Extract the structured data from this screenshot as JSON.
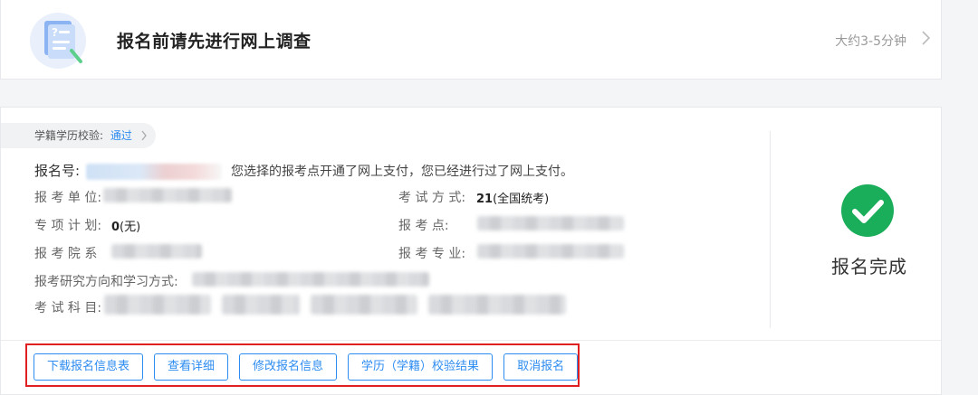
{
  "survey": {
    "title": "报名前请先进行网上调查",
    "duration": "大约3-5分钟",
    "icon": "survey-document-icon",
    "chevron_icon": "chevron-right-icon"
  },
  "verification": {
    "label": "学籍学历校验:",
    "status": "通过"
  },
  "registration": {
    "number_label": "报名号:",
    "payment_notice": "您选择的报考点开通了网上支付，您已经进行过了网上支付。",
    "left_fields": [
      {
        "label": "报 考 单 位:",
        "value": ""
      },
      {
        "label": "专 项 计 划:",
        "value_strong": "0",
        "value_rest": "(无)"
      },
      {
        "label": "报 考 院 系",
        "value": ""
      },
      {
        "label": "报考研究方向和学习方式:",
        "value": ""
      },
      {
        "label": "考 试 科 目:",
        "value": ""
      }
    ],
    "right_fields": [
      {
        "label": "考 试 方 式:",
        "value_strong": "21",
        "value_rest": "(全国统考)"
      },
      {
        "label": "报   考   点:",
        "value": ""
      },
      {
        "label": "报 考 专 业:",
        "value": ""
      }
    ]
  },
  "status": {
    "text": "报名完成",
    "icon": "check-circle-icon",
    "color": "#1aad5a"
  },
  "actions": [
    {
      "label": "下载报名信息表"
    },
    {
      "label": "查看详细"
    },
    {
      "label": "修改报名信息"
    },
    {
      "label": "学历（学籍）校验结果"
    },
    {
      "label": "取消报名"
    }
  ],
  "colors": {
    "accent": "#2d8cf0",
    "highlight": "#e02020",
    "success": "#1aad5a"
  }
}
